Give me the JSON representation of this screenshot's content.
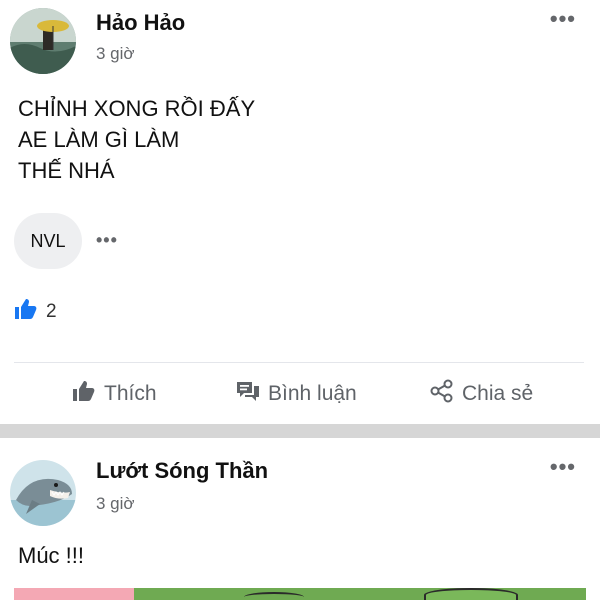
{
  "posts": [
    {
      "author": "Hảo Hảo",
      "time": "3 giờ",
      "text_lines": [
        "CHỈNH XONG RỒI ĐẤY",
        "AE LÀM GÌ LÀM",
        "THẾ NHÁ"
      ],
      "tag": "NVL",
      "more": "•••",
      "tag_more": "•••",
      "likes": "2",
      "actions": {
        "like": "Thích",
        "comment": "Bình luận",
        "share": "Chia sẻ"
      }
    },
    {
      "author": "Lướt Sóng Thần",
      "time": "3 giờ",
      "text": "Múc !!!",
      "more": "•••"
    }
  ],
  "colors": {
    "like_blue": "#1877f2",
    "gray_text": "#65676b",
    "separator": "#d6d6d6"
  },
  "icons": [
    "thumb-up-icon",
    "comment-icon",
    "share-icon",
    "more-icon"
  ]
}
